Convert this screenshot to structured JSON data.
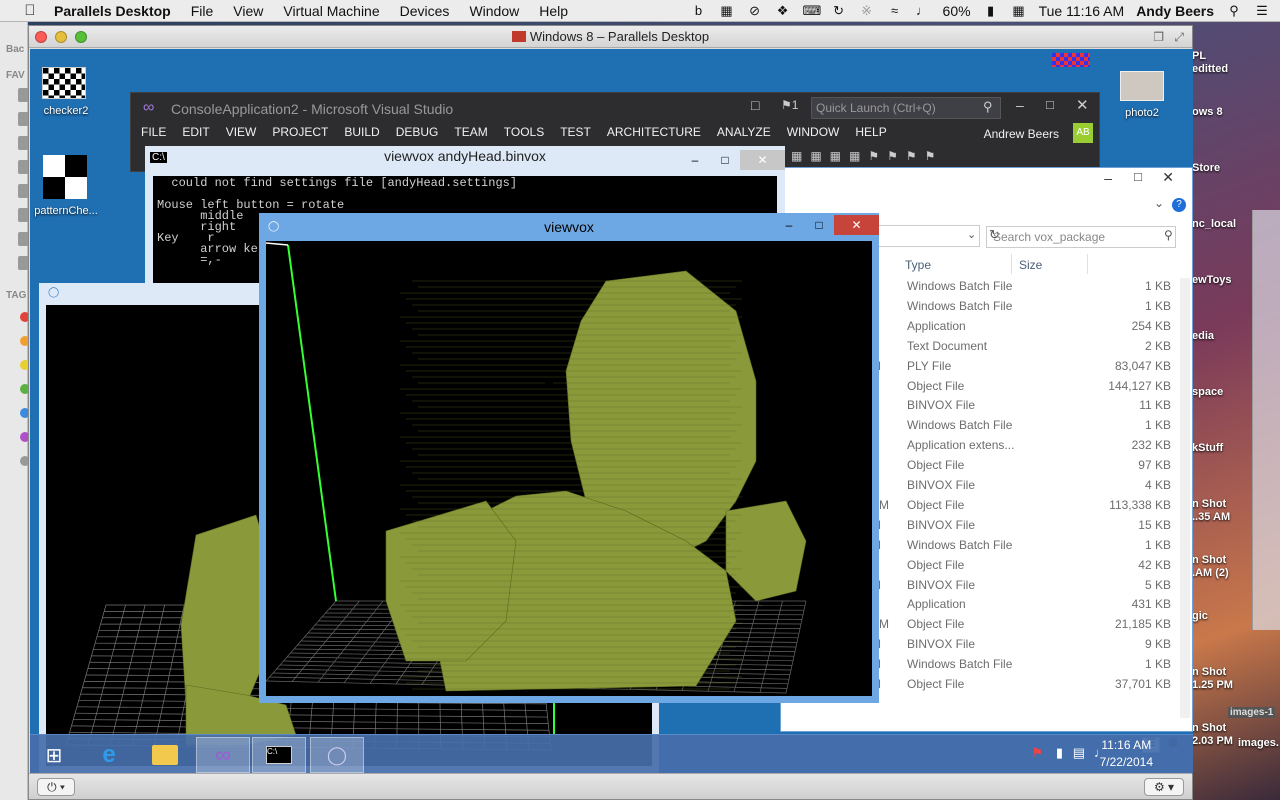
{
  "mac_menubar": {
    "app_name": "Parallels Desktop",
    "items": [
      "File",
      "View",
      "Virtual Machine",
      "Devices",
      "Window",
      "Help"
    ],
    "battery": "60%",
    "clock": "Tue 11:16 AM",
    "user": "Andy Beers"
  },
  "mac_sidebar": {
    "back_label": "Bac",
    "favorites_label": "FAV",
    "tags_label": "TAG"
  },
  "mac_desktop_right": {
    "labels": [
      "PL",
      "editted",
      "ows 8",
      "Store",
      "nc_local",
      "ewToys",
      "edia",
      "space",
      "kStuff",
      "n Shot",
      "..35 AM",
      "n Shot",
      ".AM (2)",
      "gic",
      "n Shot",
      "1.25 PM",
      "n Shot",
      "2.03 PM",
      "images-1",
      "images."
    ]
  },
  "parallels": {
    "title": "Windows 8 – Parallels Desktop"
  },
  "mac_icons": {
    "checker": "checker2",
    "pattern": "patternChe...",
    "photo": "photo2"
  },
  "visual_studio": {
    "title": "ConsoleApplication2 - Microsoft Visual Studio",
    "menu": [
      "FILE",
      "EDIT",
      "VIEW",
      "PROJECT",
      "BUILD",
      "DEBUG",
      "TEAM",
      "TOOLS",
      "TEST",
      "ARCHITECTURE",
      "ANALYZE",
      "WINDOW",
      "HELP"
    ],
    "quick_launch": "Quick Launch (Ctrl+Q)",
    "user": "Andrew Beers",
    "avatar": "AB",
    "notif_count": "1"
  },
  "console": {
    "title": "viewvox  andyHead.binvox",
    "lines": [
      "  could not find settings file [andyHead.settings]",
      "",
      "Mouse left button = rotate",
      "      middle",
      "      right",
      "Key    r",
      "      arrow ke",
      "      =,-"
    ]
  },
  "viewvox_main": {
    "title": "viewvox"
  },
  "explorer": {
    "search_placeholder": "Search vox_package",
    "col_type": "Type",
    "col_size": "Size",
    "rows": [
      {
        "m": "",
        "type": "Windows Batch File",
        "size": "1 KB"
      },
      {
        "m": "",
        "type": "Windows Batch File",
        "size": "1 KB"
      },
      {
        "m": "",
        "type": "Application",
        "size": "254 KB"
      },
      {
        "m": "",
        "type": "Text Document",
        "size": "2 KB"
      },
      {
        "m": "M",
        "type": "PLY File",
        "size": "83,047 KB"
      },
      {
        "m": "",
        "type": "Object File",
        "size": "144,127 KB"
      },
      {
        "m": "",
        "type": "BINVOX File",
        "size": "11 KB"
      },
      {
        "m": "",
        "type": "Windows Batch File",
        "size": "1 KB"
      },
      {
        "m": "",
        "type": "Application extens...",
        "size": "232 KB"
      },
      {
        "m": "",
        "type": "Object File",
        "size": "97 KB"
      },
      {
        "m": "",
        "type": "BINVOX File",
        "size": "4 KB"
      },
      {
        "m": "AM",
        "type": "Object File",
        "size": "113,338 KB"
      },
      {
        "m": "M",
        "type": "BINVOX File",
        "size": "15 KB"
      },
      {
        "m": "M",
        "type": "Windows Batch File",
        "size": "1 KB"
      },
      {
        "m": "",
        "type": "Object File",
        "size": "42 KB"
      },
      {
        "m": "M",
        "type": "BINVOX File",
        "size": "5 KB"
      },
      {
        "m": "",
        "type": "Application",
        "size": "431 KB"
      },
      {
        "m": "AM",
        "type": "Object File",
        "size": "21,185 KB"
      },
      {
        "m": "M",
        "type": "BINVOX File",
        "size": "9 KB"
      },
      {
        "m": "M",
        "type": "Windows Batch File",
        "size": "1 KB"
      },
      {
        "m": "M",
        "type": "Object File",
        "size": "37,701 KB"
      }
    ]
  },
  "taskbar": {
    "time": "11:16 AM",
    "date": "7/22/2014"
  },
  "colors": {
    "voxel": "#8a9a3a",
    "win8_blue": "#1f6fb3",
    "vs_dark": "#2d2d30"
  }
}
